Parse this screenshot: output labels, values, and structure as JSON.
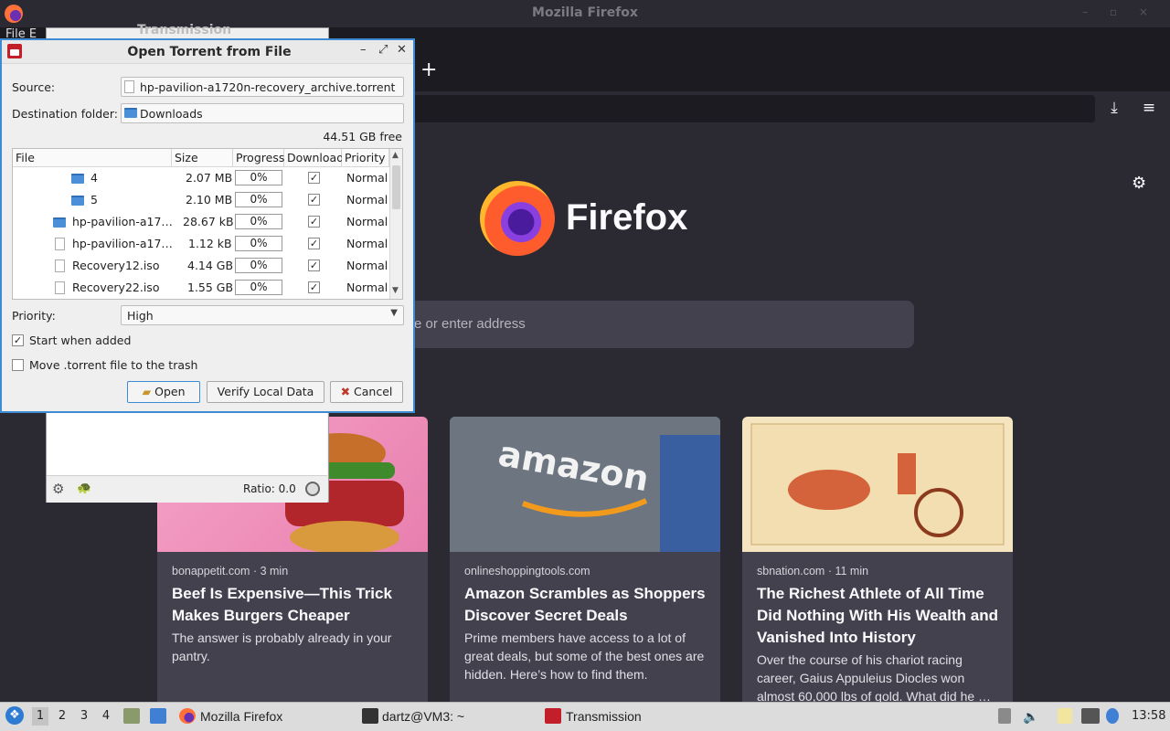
{
  "firefox": {
    "window_title": "Mozilla Firefox",
    "new_tab_label": "+",
    "wordmark": "Firefox",
    "search_placeholder": "e or enter address",
    "cards": [
      {
        "source": "bonappetit.com · 3 min",
        "title": "Beef Is Expensive—This Trick Makes Burgers Cheaper",
        "desc": "The answer is probably already in your pantry."
      },
      {
        "source": "onlineshoppingtools.com",
        "title": "Amazon Scrambles as Shoppers Discover Secret Deals",
        "desc": "Prime members have access to a lot of great deals, but some of the best ones are hidden. Here’s how to find them."
      },
      {
        "source": "sbnation.com · 11 min",
        "title": "The Richest Athlete of All Time Did Nothing With His Wealth and Vanished Into History",
        "desc": "Over the course of his chariot racing career, Gaius Appuleius Diocles won almost 60,000 lbs of gold. What did he …"
      }
    ],
    "card2_image_text": "amazon"
  },
  "transmission": {
    "window_title": "Transmission",
    "menu_partial": "File  E",
    "ratio": "Ratio: 0.0"
  },
  "dialog": {
    "title": "Open Torrent from File",
    "source_label": "Source:",
    "source_value": "hp-pavilion-a1720n-recovery_archive.torrent",
    "dest_label": "Destination folder:",
    "dest_value": "Downloads",
    "free_space": "44.51 GB free",
    "columns": [
      "File",
      "Size",
      "Progress",
      "Download",
      "Priority"
    ],
    "rows": [
      {
        "name": "4",
        "size": "2.07 MB",
        "progress": "0%",
        "download": "✓",
        "priority": "Normal"
      },
      {
        "name": "5",
        "size": "2.10 MB",
        "progress": "0%",
        "download": "✓",
        "priority": "Normal"
      },
      {
        "name": "hp-pavilion-a17…",
        "size": "28.67 kB",
        "progress": "0%",
        "download": "✓",
        "priority": "Normal"
      },
      {
        "name": "hp-pavilion-a17…",
        "size": "1.12 kB",
        "progress": "0%",
        "download": "✓",
        "priority": "Normal"
      },
      {
        "name": "Recovery12.iso",
        "size": "4.14 GB",
        "progress": "0%",
        "download": "✓",
        "priority": "Normal"
      },
      {
        "name": "Recovery22.iso",
        "size": "1.55 GB",
        "progress": "0%",
        "download": "✓",
        "priority": "Normal"
      }
    ],
    "priority_label": "Priority:",
    "priority_value": "High",
    "start_when_added": "Start when added",
    "start_checked": "✓",
    "move_trash": "Move .torrent file to the trash",
    "buttons": {
      "open": "Open",
      "verify": "Verify Local Data",
      "cancel": "Cancel"
    }
  },
  "taskbar": {
    "workspaces": [
      "1",
      "2",
      "3",
      "4"
    ],
    "tasks": [
      "Mozilla Firefox",
      "dartz@VM3: ~",
      "Transmission"
    ],
    "clock": "13:58"
  }
}
